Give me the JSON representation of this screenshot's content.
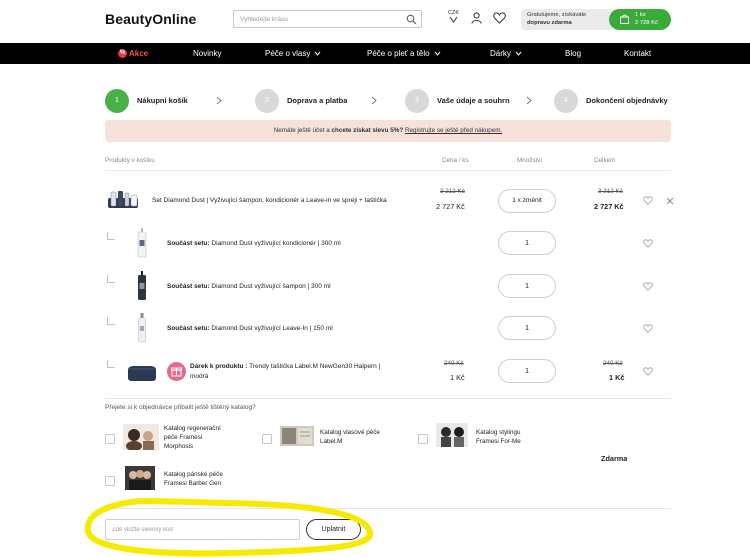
{
  "header": {
    "logo": "BeautyOnline",
    "search_placeholder": "Vyhledejte krásu",
    "currency": "CZK",
    "promo_line1": "Gratulujeme, získáváte",
    "promo_line2": "dopravu zdarma",
    "cart_count": "1 ks",
    "cart_total": "2 728 Kč"
  },
  "nav": [
    {
      "label": "Akce",
      "badge": "%"
    },
    {
      "label": "Novinky"
    },
    {
      "label": "Péče o vlasy"
    },
    {
      "label": "Péče o pleť a tělo"
    },
    {
      "label": "Dárky"
    },
    {
      "label": "Blog"
    },
    {
      "label": "Kontakt"
    }
  ],
  "steps": [
    {
      "num": "1",
      "label": "Nákupní košík"
    },
    {
      "num": "2",
      "label": "Doprava a platba"
    },
    {
      "num": "3",
      "label": "Vaše údaje a souhrn"
    },
    {
      "num": "4",
      "label": "Dokončení objednávky"
    }
  ],
  "info": {
    "text1": "Nemáte ještě účet a ",
    "bold": "chcete získat slevu 5%?",
    "text2": " ",
    "link": "Registrujte se ještě před nákupem."
  },
  "table": {
    "col_products": "Produkty v košíku",
    "col_price": "Cena / ks",
    "col_qty": "Množství",
    "col_total": "Celkem"
  },
  "items": {
    "main": {
      "name": "Set Diamond Dust | Vyživující šampon, kondicionér a Leave-in ve spreji + taštička",
      "old_price": "3 212 Kč",
      "price": "2 727 Kč",
      "qty": "1 x změnit",
      "old_total": "3 212 Kč",
      "total": "2 727 Kč"
    },
    "set_label": "Součást setu:",
    "sub": [
      {
        "name": " Diamond Dust vyživující kondicionér | 300 ml",
        "qty": "1"
      },
      {
        "name": " Diamond Dust vyživující šampon | 300 ml",
        "qty": "1"
      },
      {
        "name": " Diamond Dust vyživující Leave-In | 150 ml",
        "qty": "1"
      }
    ],
    "gift": {
      "label": "Dárek k produktu :",
      "name1": " Trendy taštička Label.M NewGen30 Halpern |",
      "name2": "modrá",
      "old_price": "240 Kč",
      "price": "1 Kč",
      "qty": "1",
      "old_total": "240 Kč",
      "total": "1 Kč"
    }
  },
  "catalogs": {
    "question": "Přejete si k objednávce přibalit ještě tištěný katalog?",
    "list": [
      {
        "line1": "Katalog regenerační",
        "line2": "péče Framesi",
        "line3": "Morphosis"
      },
      {
        "line1": "Katalog vlasové péče",
        "line2": "Label.M"
      },
      {
        "line1": "Katalog stylingu",
        "line2": "Framesi For-Me"
      },
      {
        "line1": "Katalog pánské péče",
        "line2": "Framesi Barber Gen"
      }
    ],
    "price": "Zdarma"
  },
  "coupon": {
    "placeholder": "Zde vložte slevový kód",
    "button": "Uplatnit"
  },
  "colors": {
    "accent_green": "#47b047",
    "nav_bg": "#000000",
    "info_bg": "#f7e1db",
    "highlight": "#f5ea00"
  }
}
